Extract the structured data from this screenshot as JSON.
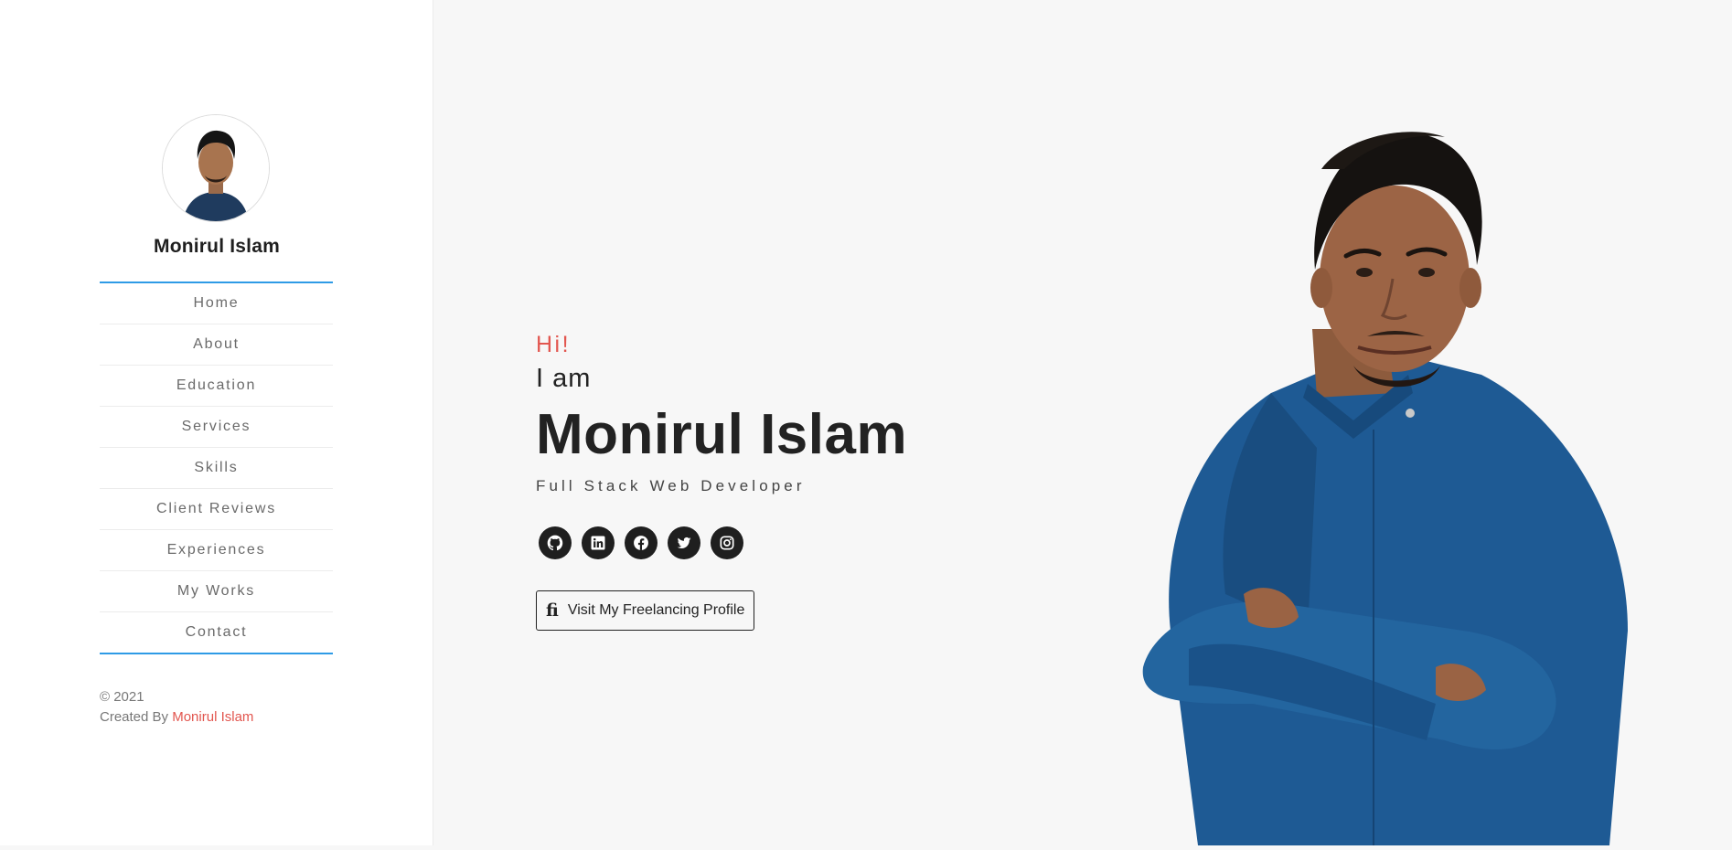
{
  "sidebar": {
    "name": "Monirul Islam",
    "nav": [
      {
        "label": "Home"
      },
      {
        "label": "About"
      },
      {
        "label": "Education"
      },
      {
        "label": "Services"
      },
      {
        "label": "Skills"
      },
      {
        "label": "Client Reviews"
      },
      {
        "label": "Experiences"
      },
      {
        "label": "My Works"
      },
      {
        "label": "Contact"
      }
    ],
    "copyright": "© 2021",
    "created_by": "Created By",
    "author": "Monirul Islam"
  },
  "hero": {
    "greeting": "Hi!",
    "intro": "I am",
    "name": "Monirul Islam",
    "role": "Full Stack Web Developer",
    "socials": [
      {
        "icon": "github-icon"
      },
      {
        "icon": "linkedin-icon"
      },
      {
        "icon": "facebook-icon"
      },
      {
        "icon": "twitter-icon"
      },
      {
        "icon": "instagram-icon"
      }
    ],
    "cta_icon": "fi",
    "cta_label": "Visit My Freelancing Profile"
  },
  "colors": {
    "accent_red": "#e2564f",
    "accent_blue": "#2e9be6",
    "dark": "#1f1f1f",
    "background": "#f7f7f7"
  }
}
